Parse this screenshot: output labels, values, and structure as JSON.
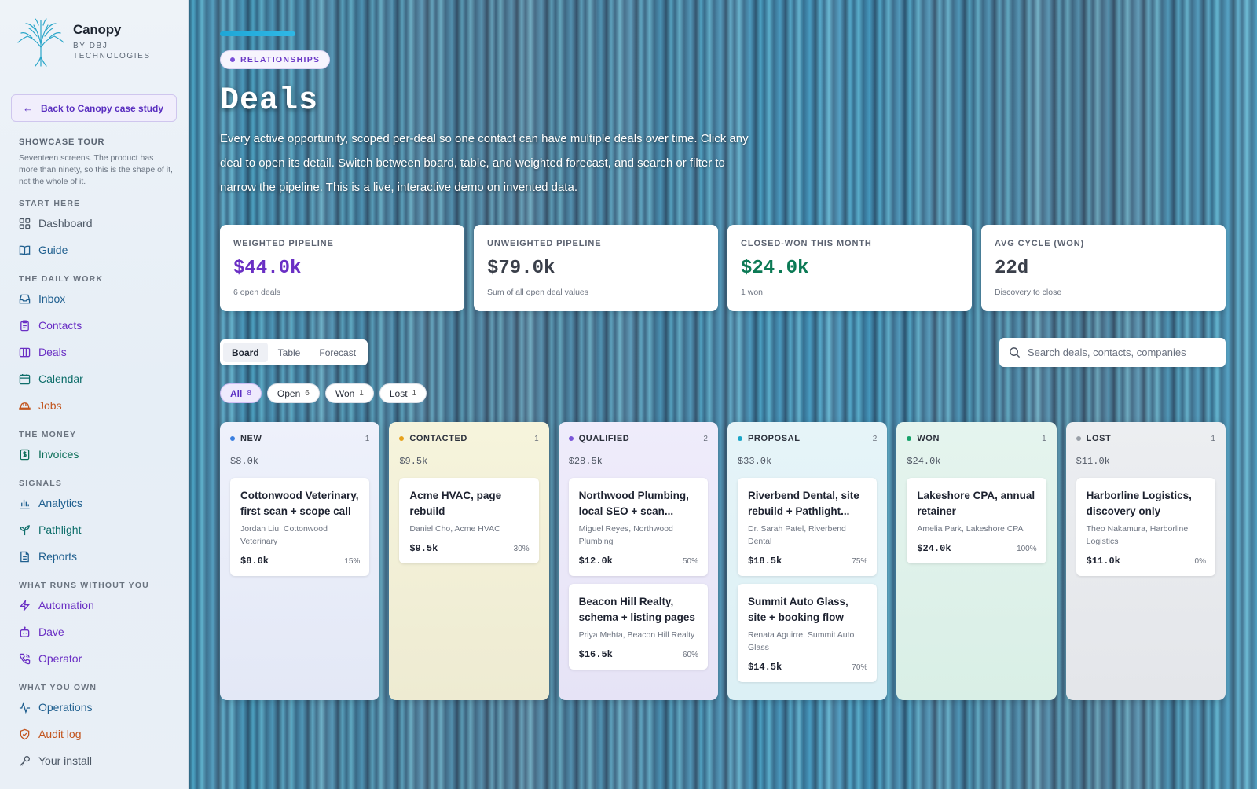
{
  "brand": {
    "name": "Canopy",
    "sub_line1": "BY DBJ",
    "sub_line2": "TECHNOLOGIES"
  },
  "back_link": "Back to Canopy case study",
  "tour": {
    "title": "SHOWCASE TOUR",
    "description": "Seventeen screens. The product has more than ninety, so this is the shape of it, not the whole of it."
  },
  "nav": {
    "start_here": {
      "label": "START HERE",
      "items": [
        "Dashboard",
        "Guide"
      ]
    },
    "daily_work": {
      "label": "THE DAILY WORK",
      "items": [
        "Inbox",
        "Contacts",
        "Deals",
        "Calendar",
        "Jobs"
      ]
    },
    "money": {
      "label": "THE MONEY",
      "items": [
        "Invoices"
      ]
    },
    "signals": {
      "label": "SIGNALS",
      "items": [
        "Analytics",
        "Pathlight",
        "Reports"
      ]
    },
    "runs_without_you": {
      "label": "WHAT RUNS WITHOUT YOU",
      "items": [
        "Automation",
        "Dave",
        "Operator"
      ]
    },
    "you_own": {
      "label": "WHAT YOU OWN",
      "items": [
        "Operations",
        "Audit log",
        "Your install"
      ]
    }
  },
  "header": {
    "chip": "RELATIONSHIPS",
    "title": "Deals",
    "description": "Every active opportunity, scoped per-deal so one contact can have multiple deals over time. Click any deal to open its detail. Switch between board, table, and weighted forecast, and search or filter to narrow the pipeline. This is a live, interactive demo on invented data."
  },
  "stats": [
    {
      "label": "WEIGHTED PIPELINE",
      "value": "$44.0k",
      "note": "6 open deals",
      "color": "#6a2fc4"
    },
    {
      "label": "UNWEIGHTED PIPELINE",
      "value": "$79.0k",
      "note": "Sum of all open deal values",
      "color": "#3a3f4a"
    },
    {
      "label": "CLOSED-WON THIS MONTH",
      "value": "$24.0k",
      "note": "1 won",
      "color": "#0c7a55"
    },
    {
      "label": "AVG CYCLE (WON)",
      "value": "22d",
      "note": "Discovery to close",
      "color": "#3a3f4a"
    }
  ],
  "view_tabs": [
    "Board",
    "Table",
    "Forecast"
  ],
  "search": {
    "placeholder": "Search deals, contacts, companies"
  },
  "filters": [
    {
      "label": "All",
      "count": "8"
    },
    {
      "label": "Open",
      "count": "6"
    },
    {
      "label": "Won",
      "count": "1"
    },
    {
      "label": "Lost",
      "count": "1"
    }
  ],
  "columns": [
    {
      "name": "NEW",
      "count": "1",
      "total": "$8.0k",
      "dot": "#3b7fe0",
      "cards": [
        {
          "title": "Cottonwood Veterinary, first scan + scope call",
          "sub": "Jordan Liu, Cottonwood Veterinary",
          "amount": "$8.0k",
          "pct": "15%"
        }
      ]
    },
    {
      "name": "CONTACTED",
      "count": "1",
      "total": "$9.5k",
      "dot": "#e6a11a",
      "cards": [
        {
          "title": "Acme HVAC, page rebuild",
          "sub": "Daniel Cho, Acme HVAC",
          "amount": "$9.5k",
          "pct": "30%"
        }
      ]
    },
    {
      "name": "QUALIFIED",
      "count": "2",
      "total": "$28.5k",
      "dot": "#7a55d8",
      "cards": [
        {
          "title": "Northwood Plumbing, local SEO + scan...",
          "sub": "Miguel Reyes, Northwood Plumbing",
          "amount": "$12.0k",
          "pct": "50%"
        },
        {
          "title": "Beacon Hill Realty, schema + listing pages",
          "sub": "Priya Mehta, Beacon Hill Realty",
          "amount": "$16.5k",
          "pct": "60%"
        }
      ]
    },
    {
      "name": "PROPOSAL",
      "count": "2",
      "total": "$33.0k",
      "dot": "#1aa6c8",
      "cards": [
        {
          "title": "Riverbend Dental, site rebuild + Pathlight...",
          "sub": "Dr. Sarah Patel, Riverbend Dental",
          "amount": "$18.5k",
          "pct": "75%"
        },
        {
          "title": "Summit Auto Glass, site + booking flow",
          "sub": "Renata Aguirre, Summit Auto Glass",
          "amount": "$14.5k",
          "pct": "70%"
        }
      ]
    },
    {
      "name": "WON",
      "count": "1",
      "total": "$24.0k",
      "dot": "#17a36a",
      "cards": [
        {
          "title": "Lakeshore CPA, annual retainer",
          "sub": "Amelia Park, Lakeshore CPA",
          "amount": "$24.0k",
          "pct": "100%"
        }
      ]
    },
    {
      "name": "LOST",
      "count": "1",
      "total": "$11.0k",
      "dot": "#9aa0a8",
      "cards": [
        {
          "title": "Harborline Logistics, discovery only",
          "sub": "Theo Nakamura, Harborline Logistics",
          "amount": "$11.0k",
          "pct": "0%"
        }
      ]
    }
  ]
}
